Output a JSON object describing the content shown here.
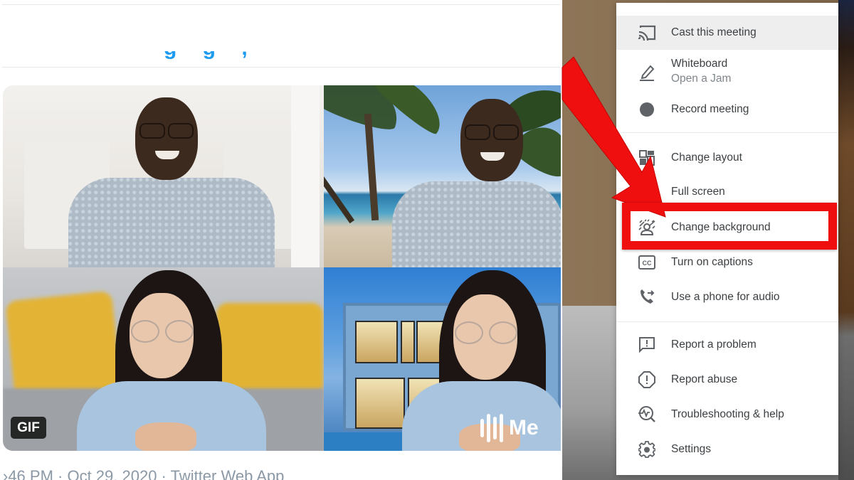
{
  "tweet": {
    "text_fragment": "g g ,",
    "meta": "›46 PM · Oct 29, 2020 · Twitter Web App",
    "media": {
      "badge": "GIF",
      "watermark": "Me",
      "tiles": [
        {
          "subject": "man",
          "background": "plain room"
        },
        {
          "subject": "man",
          "background": "beach with palm trees"
        },
        {
          "subject": "woman",
          "background": "couch with yellow cushions"
        },
        {
          "subject": "woman",
          "background": "modern house at dusk"
        }
      ]
    }
  },
  "menu": {
    "sections": [
      {
        "items": [
          {
            "label": "Cast this meeting",
            "icon": "cast-icon",
            "highlighted": true
          },
          {
            "label": "Whiteboard",
            "sublabel": "Open a Jam",
            "icon": "pencil-icon"
          },
          {
            "label": "Record meeting",
            "icon": "record-icon"
          }
        ]
      },
      {
        "items": [
          {
            "label": "Change layout",
            "icon": "layout-icon"
          },
          {
            "label": "Full screen",
            "icon": "fullscreen-icon"
          },
          {
            "label": "Change background",
            "icon": "background-effects-icon",
            "annotated": true
          },
          {
            "label": "Turn on captions",
            "icon": "captions-icon"
          },
          {
            "label": "Use a phone for audio",
            "icon": "phone-forward-icon"
          }
        ]
      },
      {
        "items": [
          {
            "label": "Report a problem",
            "icon": "feedback-icon"
          },
          {
            "label": "Report abuse",
            "icon": "report-icon"
          },
          {
            "label": "Troubleshooting & help",
            "icon": "troubleshoot-icon"
          },
          {
            "label": "Settings",
            "icon": "gear-icon"
          }
        ]
      }
    ]
  },
  "annotation": {
    "color": "#ef0f0f",
    "target": "Change background",
    "type": "arrow-and-box"
  },
  "colors": {
    "menu_text": "#3c4043",
    "menu_subtext": "#80868b",
    "icon": "#5f6368",
    "highlight_row": "#eeeeee",
    "twitter_blue": "#1d9bf0"
  }
}
